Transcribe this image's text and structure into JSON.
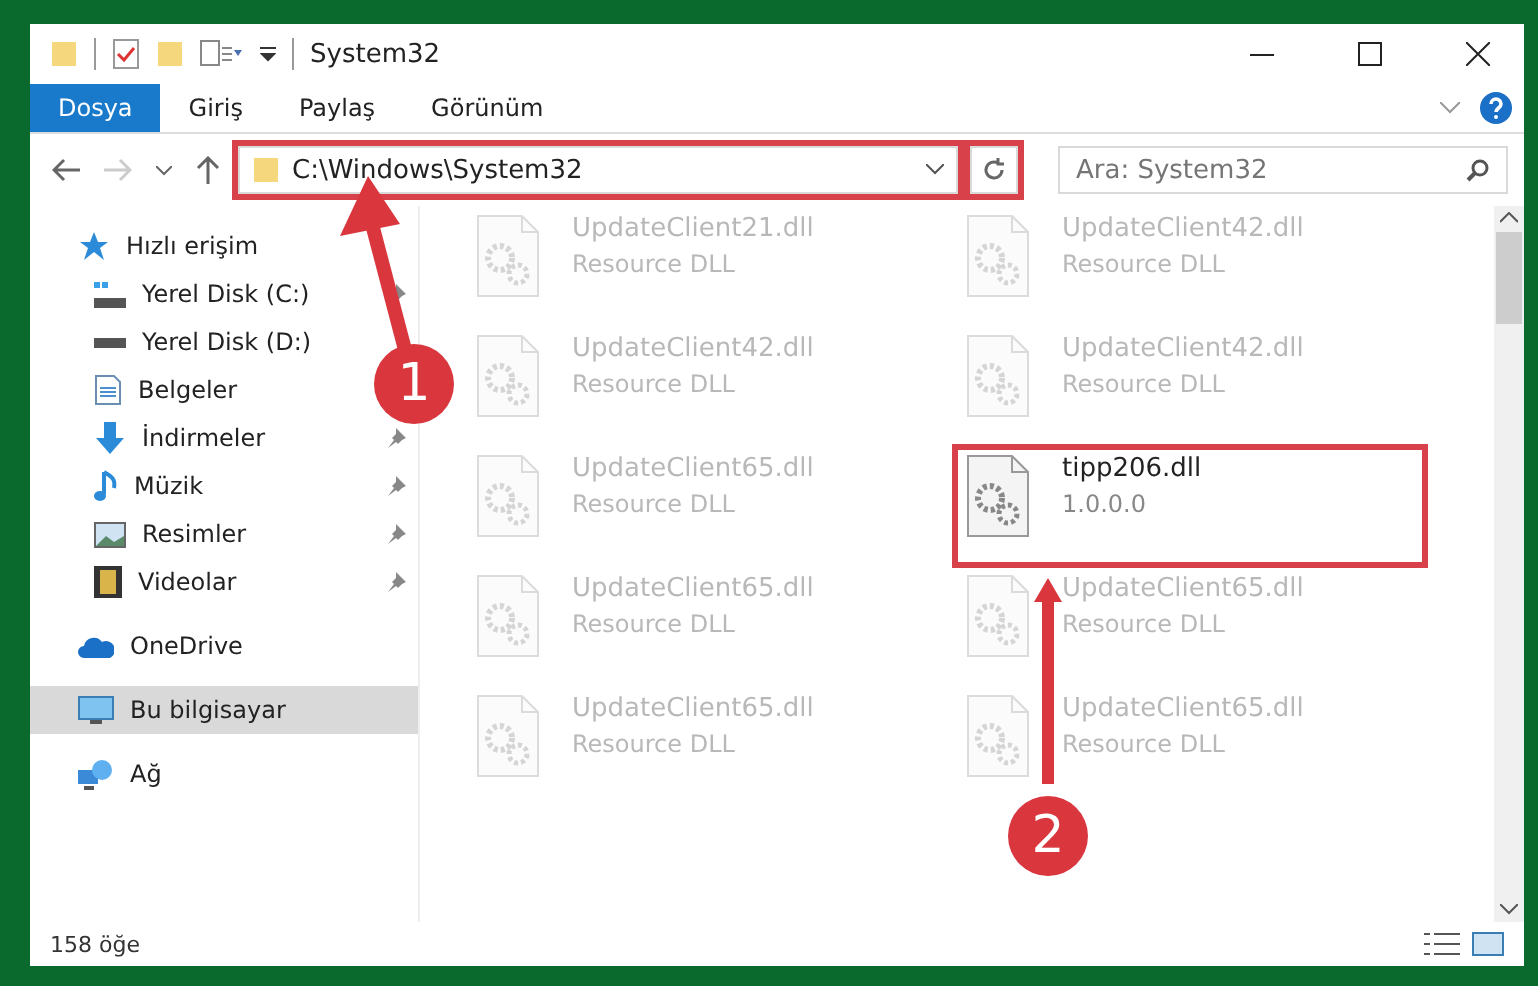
{
  "window": {
    "title": "System32"
  },
  "ribbon_tabs": [
    {
      "label": "Dosya",
      "selected": true
    },
    {
      "label": "Giriş",
      "selected": false
    },
    {
      "label": "Paylaş",
      "selected": false
    },
    {
      "label": "Görünüm",
      "selected": false
    }
  ],
  "address_bar": {
    "path": "C:\\Windows\\System32",
    "highlighted": true
  },
  "search": {
    "placeholder": "Ara: System32"
  },
  "sidebar": {
    "items": [
      {
        "label": "Hızlı erişim",
        "pinned": false,
        "selected": false,
        "children": [
          {
            "label": "Yerel Disk (C:)",
            "pinned": true,
            "selected": false
          },
          {
            "label": "Yerel Disk (D:)",
            "pinned": false,
            "selected": false
          },
          {
            "label": "Belgeler",
            "pinned": false,
            "selected": false
          },
          {
            "label": "İndirmeler",
            "pinned": true,
            "selected": false
          },
          {
            "label": "Müzik",
            "pinned": true,
            "selected": false
          },
          {
            "label": "Resimler",
            "pinned": true,
            "selected": false
          },
          {
            "label": "Videolar",
            "pinned": true,
            "selected": false
          }
        ]
      },
      {
        "label": "OneDrive",
        "pinned": false,
        "selected": false
      },
      {
        "label": "Bu bilgisayar",
        "pinned": false,
        "selected": true
      },
      {
        "label": "Ağ",
        "pinned": false,
        "selected": false
      }
    ]
  },
  "files": [
    {
      "name": "UpdateClient21.dll",
      "detail": "Resource DLL",
      "faded": true,
      "highlighted": false
    },
    {
      "name": "UpdateClient42.dll",
      "detail": "Resource DLL",
      "faded": true,
      "highlighted": false
    },
    {
      "name": "UpdateClient42.dll",
      "detail": "Resource DLL",
      "faded": true,
      "highlighted": false
    },
    {
      "name": "UpdateClient42.dll",
      "detail": "Resource DLL",
      "faded": true,
      "highlighted": false
    },
    {
      "name": "UpdateClient65.dll",
      "detail": "Resource DLL",
      "faded": true,
      "highlighted": false
    },
    {
      "name": "tipp206.dll",
      "detail": "1.0.0.0",
      "faded": false,
      "highlighted": true
    },
    {
      "name": "UpdateClient65.dll",
      "detail": "Resource DLL",
      "faded": true,
      "highlighted": false
    },
    {
      "name": "UpdateClient65.dll",
      "detail": "Resource DLL",
      "faded": true,
      "highlighted": false
    },
    {
      "name": "UpdateClient65.dll",
      "detail": "Resource DLL",
      "faded": true,
      "highlighted": false
    },
    {
      "name": "UpdateClient65.dll",
      "detail": "Resource DLL",
      "faded": true,
      "highlighted": false
    }
  ],
  "status_bar": {
    "count": "158 öğe"
  },
  "annotations": [
    {
      "number": "1"
    },
    {
      "number": "2"
    }
  ]
}
